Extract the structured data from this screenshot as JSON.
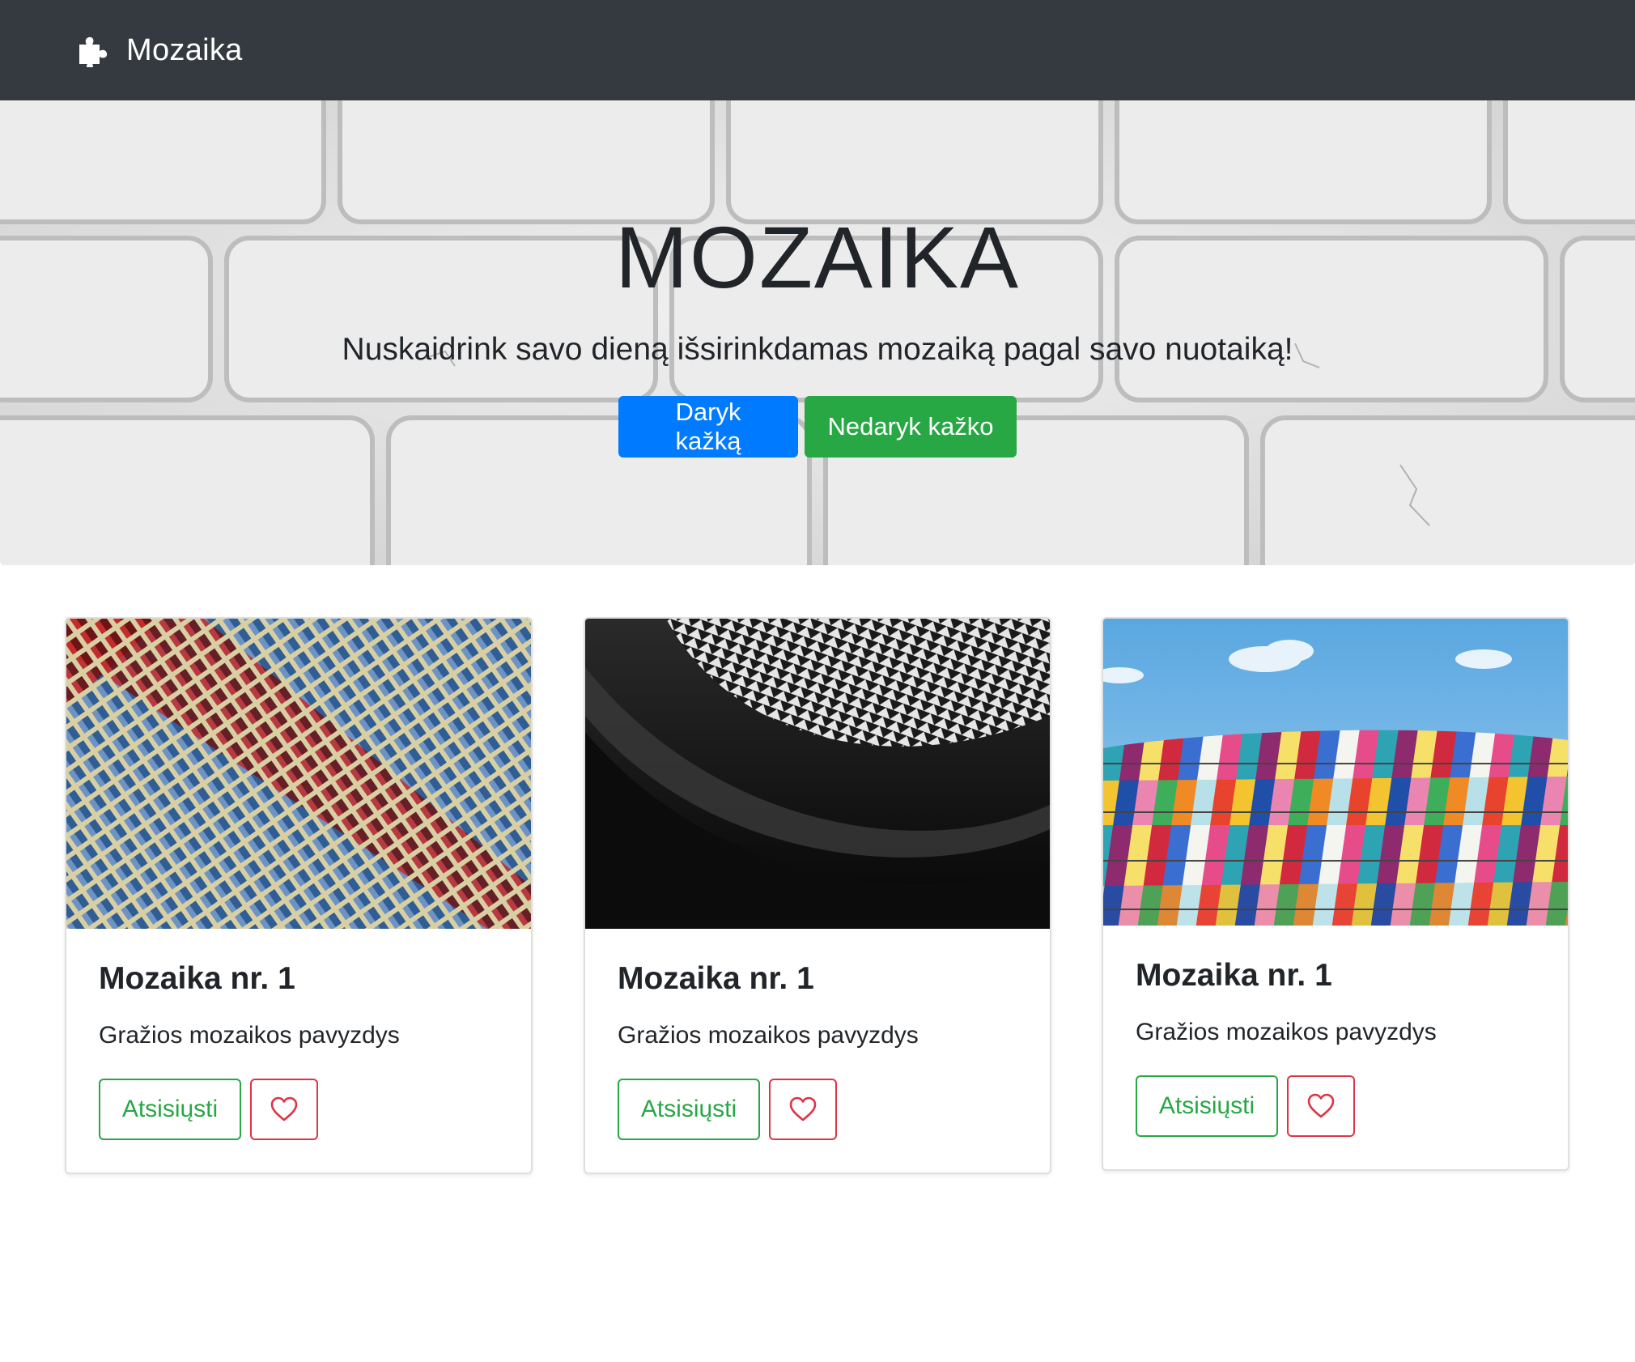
{
  "navbar": {
    "brand_icon": "puzzle-icon",
    "brand_text": "Mozaika"
  },
  "hero": {
    "title": "MOZAIKA",
    "lead": "Nuskaidrink savo dieną išsirinkdamas mozaiką pagal savo nuotaiką!",
    "primary_button": "Daryk kažką",
    "secondary_button": "Nedaryk kažko",
    "background": "white-brick-wall-image"
  },
  "cards": [
    {
      "image": "blue-red-building-facade-image",
      "title": "Mozaika nr. 1",
      "text": "Gražios mozaikos pavyzdys",
      "download_label": "Atsisiųsti",
      "like_icon": "heart-icon"
    },
    {
      "image": "black-white-wave-architecture-image",
      "title": "Mozaika nr. 1",
      "text": "Gražios mozaikos pavyzdys",
      "download_label": "Atsisiųsti",
      "like_icon": "heart-icon"
    },
    {
      "image": "colorful-glass-facade-sky-image",
      "title": "Mozaika nr. 1",
      "text": "Gražios mozaikos pavyzdys",
      "download_label": "Atsisiųsti",
      "like_icon": "heart-icon"
    }
  ],
  "colors": {
    "navbar_bg": "#343a40",
    "primary": "#007bff",
    "success": "#28a745",
    "danger": "#dc3545"
  }
}
